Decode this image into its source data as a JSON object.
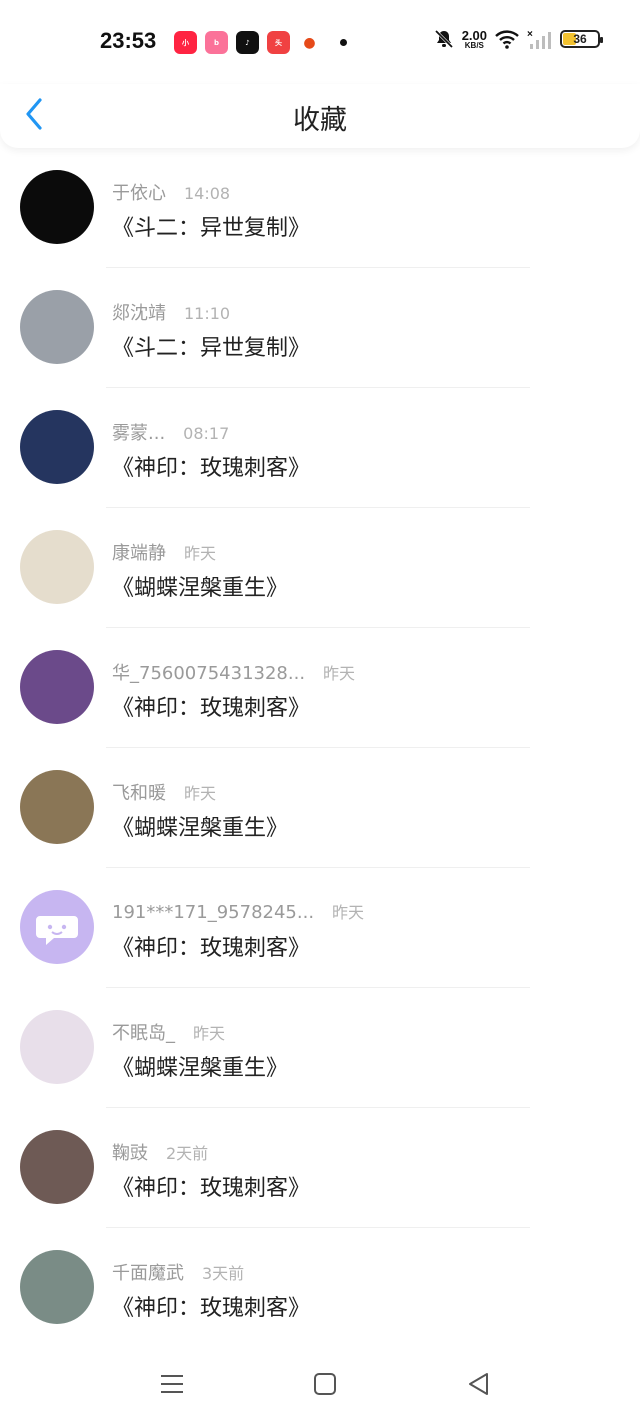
{
  "status_bar": {
    "time": "23:53",
    "app_icons": [
      "xiaohongshu-icon",
      "bilibili-icon",
      "douyin-icon",
      "toutiao-icon",
      "app-icon"
    ],
    "net_speed_value": "2.00",
    "net_speed_unit": "KB/S",
    "battery_level": "36"
  },
  "header": {
    "title": "收藏"
  },
  "list": [
    {
      "name": "于依心",
      "time": "14:08",
      "message": "《斗二：异世复制》",
      "avatar_color": "#0b0b0b"
    },
    {
      "name": "郯沈靖",
      "time": "11:10",
      "message": "《斗二：异世复制》",
      "avatar_color": "#9aa0a8"
    },
    {
      "name": "雾蒙...",
      "time": "08:17",
      "message": "《神印：玫瑰刺客》",
      "avatar_color": "#25355f"
    },
    {
      "name": "康端静",
      "time": "昨天",
      "message": "《蝴蝶涅槃重生》",
      "avatar_color": "#e5ddcd"
    },
    {
      "name": "华_7560075431328...",
      "time": "昨天",
      "message": "《神印：玫瑰刺客》",
      "avatar_color": "#6b4a8a"
    },
    {
      "name": "飞和暖",
      "time": "昨天",
      "message": "《蝴蝶涅槃重生》",
      "avatar_color": "#8a7656"
    },
    {
      "name": "191***171_9578245...",
      "time": "昨天",
      "message": "《神印：玫瑰刺客》",
      "avatar_color": "#c7b6f1"
    },
    {
      "name": "不眠岛_",
      "time": "昨天",
      "message": "《蝴蝶涅槃重生》",
      "avatar_color": "#e8dfea"
    },
    {
      "name": "鞠豉",
      "time": "2天前",
      "message": "《神印：玫瑰刺客》",
      "avatar_color": "#6e5a55"
    },
    {
      "name": "千面魔武",
      "time": "3天前",
      "message": "《神印：玫瑰刺客》",
      "avatar_color": "#7a8c86"
    }
  ],
  "nav_bar": {
    "buttons": [
      "menu-icon",
      "home-icon",
      "back-triangle-icon"
    ]
  },
  "colors": {
    "accent": "#2196f3",
    "text_primary": "#222222",
    "text_secondary": "#9a9a9a"
  }
}
